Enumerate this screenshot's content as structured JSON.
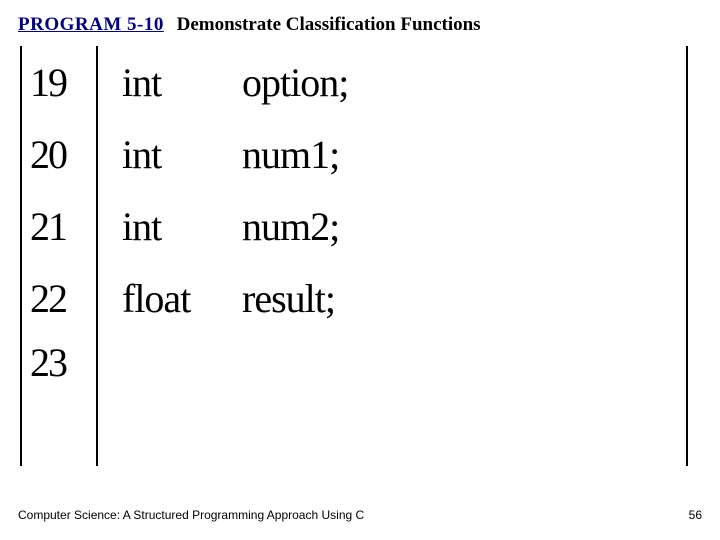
{
  "header": {
    "program_label": "PROGRAM 5-10",
    "title": "Demonstrate Classification Functions"
  },
  "code": {
    "lines": [
      {
        "number": "19",
        "keyword": "int",
        "identifier": "option;"
      },
      {
        "number": "20",
        "keyword": "int",
        "identifier": "num1;"
      },
      {
        "number": "21",
        "keyword": "int",
        "identifier": "num2;"
      },
      {
        "number": "22",
        "keyword": "float",
        "identifier": "result;"
      },
      {
        "number": "23",
        "keyword": "",
        "identifier": ""
      }
    ]
  },
  "footer": {
    "book": "Computer Science: A Structured Programming Approach Using C",
    "page": "56"
  }
}
